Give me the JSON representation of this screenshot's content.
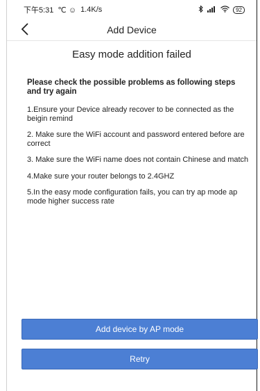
{
  "status_bar": {
    "time": "下午5:31",
    "left_icons": "℃ ☺",
    "speed": "1.4K/s",
    "battery": "92"
  },
  "header": {
    "title": "Add Device",
    "back_icon": "chevron-left-icon"
  },
  "main": {
    "heading": "Easy mode addition failed",
    "intro": "Please check the possible problems as following steps and try again",
    "steps": [
      "1.Ensure your Device already recover to be connected as the beigin remind",
      "2. Make sure the WiFi account and password entered before are correct",
      "3. Make sure the WiFi name does not contain Chinese and match",
      "4.Make sure your router belongs to 2.4GHZ",
      "5.In the easy mode configuration fails, you can try ap mode ap mode higher success rate"
    ]
  },
  "buttons": {
    "ap_mode_label": "Add device by AP mode",
    "retry_label": "Retry"
  },
  "colors": {
    "button_blue": "#4c7fd4",
    "background": "#ffffff"
  }
}
